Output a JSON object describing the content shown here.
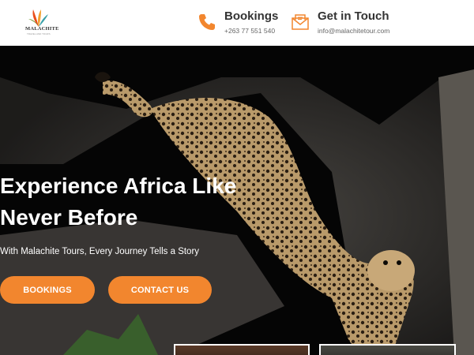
{
  "header": {
    "logo": {
      "wordmark": "MALACHITE",
      "tagline": "TRAVEL AND TOURS"
    },
    "bookings": {
      "title": "Bookings",
      "phone": "+263 77 551 540",
      "icon": "phone-icon"
    },
    "contact": {
      "title": "Get in Touch",
      "email": "info@malachitetour.com",
      "icon": "envelope-icon"
    }
  },
  "hero": {
    "headline": "Experience Africa Like Never Before",
    "subline": "With Malachite Tours, Every Journey Tells a Story",
    "buttons": {
      "bookings": "BOOKINGS",
      "contact": "CONTACT US"
    },
    "image": "leopard-on-tree"
  },
  "colors": {
    "accent": "#f2862e",
    "header_bg": "#ffffff",
    "hero_bg": "#050505"
  }
}
